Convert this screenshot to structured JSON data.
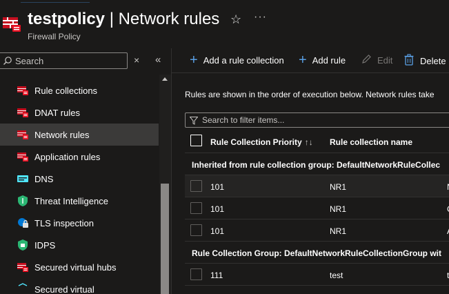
{
  "header": {
    "title_bold": "testpolicy",
    "title_rest": " | Network rules",
    "subtitle": "Firewall Policy",
    "favorite_icon": "star-icon",
    "more_icon": "ellipsis-icon",
    "more_label": "···"
  },
  "sidebar": {
    "search_placeholder": "Search",
    "clear_label": "×",
    "collapse_label": "«",
    "items": [
      {
        "label": "Rule collections",
        "icon": "firewall-policy-icon"
      },
      {
        "label": "DNAT rules",
        "icon": "firewall-policy-icon"
      },
      {
        "label": "Network rules",
        "icon": "firewall-policy-icon",
        "active": true
      },
      {
        "label": "Application rules",
        "icon": "firewall-policy-icon"
      },
      {
        "label": "DNS",
        "icon": "dns-icon"
      },
      {
        "label": "Threat Intelligence",
        "icon": "shield-icon"
      },
      {
        "label": "TLS inspection",
        "icon": "lock-icon"
      },
      {
        "label": "IDPS",
        "icon": "idps-shield-icon"
      },
      {
        "label": "Secured virtual hubs",
        "icon": "firewall-policy-icon"
      },
      {
        "label": "Secured virtual",
        "icon": "network-icon"
      }
    ]
  },
  "toolbar": {
    "add_collection": "Add a rule collection",
    "add_rule": "Add rule",
    "edit": "Edit",
    "delete": "Delete"
  },
  "main": {
    "description": "Rules are shown in the order of execution below. Network rules take",
    "filter_placeholder": "Search to filter items...",
    "columns": {
      "priority": "Rule Collection Priority",
      "priority_sort": "↑↓",
      "name": "Rule collection name"
    },
    "groups": [
      {
        "label": "Inherited from rule collection group: DefaultNetworkRuleCollec",
        "rows": [
          {
            "priority": "101",
            "name": "NR1",
            "extra": "N"
          },
          {
            "priority": "101",
            "name": "NR1",
            "extra": "C"
          },
          {
            "priority": "101",
            "name": "NR1",
            "extra": "A"
          }
        ]
      },
      {
        "label": "Rule Collection Group: DefaultNetworkRuleCollectionGroup wit",
        "rows": [
          {
            "priority": "111",
            "name": "test",
            "extra": "t"
          }
        ]
      }
    ]
  },
  "colors": {
    "accent": "#5aa0e6",
    "background": "#1b1a19",
    "active_nav": "#3b3a39",
    "firewall_red": "#e81123"
  }
}
